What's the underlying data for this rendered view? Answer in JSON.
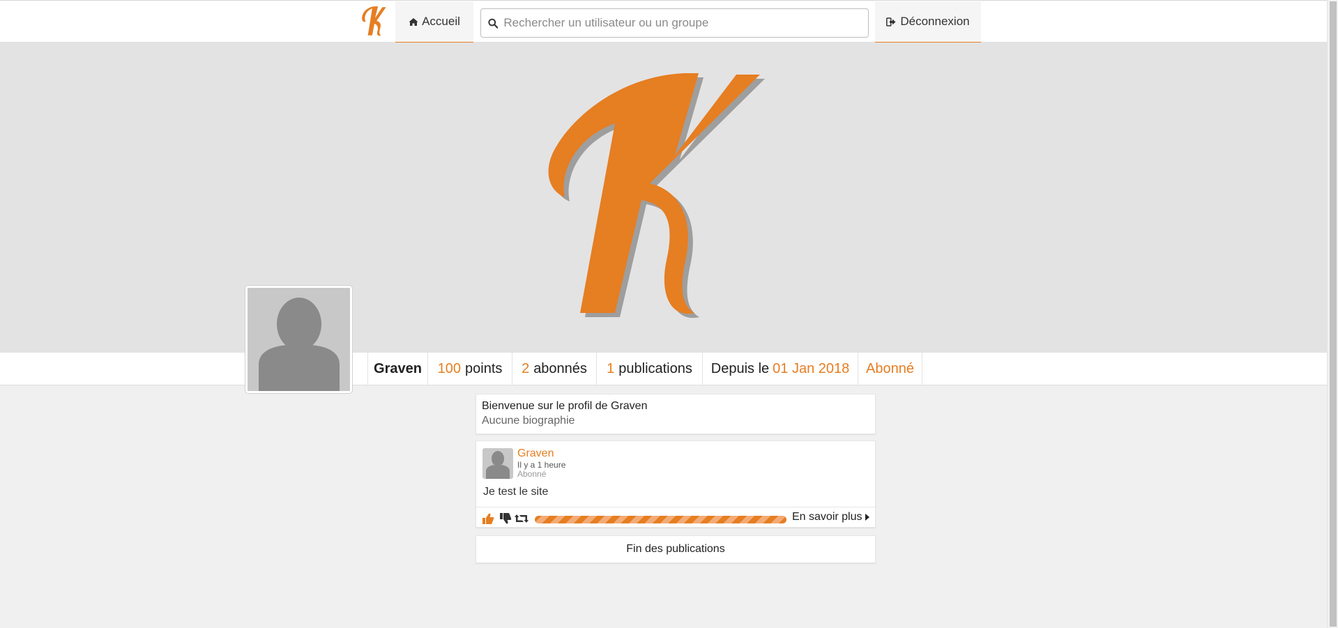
{
  "navbar": {
    "home_label": "Accueil",
    "search_placeholder": "Rechercher un utilisateur ou un groupe",
    "logout_label": "Déconnexion",
    "logo_letter": "K",
    "accent_color": "#e67e22"
  },
  "profile": {
    "name": "Graven",
    "points_value": "100",
    "points_label": "points",
    "followers_value": "2",
    "followers_label": "abonnés",
    "posts_value": "1",
    "posts_label": "publications",
    "since_label": "Depuis le",
    "since_date": "01 Jan 2018",
    "follow_label": "Abonné"
  },
  "bio": {
    "title": "Bienvenue sur le profil de Graven",
    "text": "Aucune biographie"
  },
  "post": {
    "author": "Graven",
    "time": "Il y a 1 heure",
    "status": "Abonné",
    "body": "Je test le site",
    "progress": 1.0,
    "more_label": "En savoir plus",
    "icons": [
      "thumbs-up-icon",
      "thumbs-down-icon",
      "retweet-icon"
    ]
  },
  "feed": {
    "end_label": "Fin des publications"
  }
}
